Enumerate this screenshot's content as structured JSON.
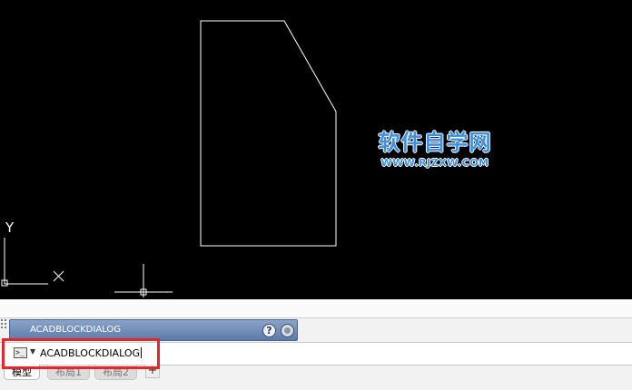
{
  "watermark": {
    "title": "软件自学网",
    "url": "WWW.RJZXW.COM"
  },
  "ucs": {
    "y_label": "Y",
    "x_label": "X"
  },
  "command_history": {
    "text": "ACADBLOCKDIALOG",
    "help_icon": "?"
  },
  "command_line": {
    "prompt_icon": ">_",
    "text": "ACADBLOCKDIALOG"
  },
  "tabs": [
    {
      "label": "模型",
      "active": true
    },
    {
      "label": "布局1",
      "active": false
    },
    {
      "label": "布局2",
      "active": false
    }
  ],
  "add_tab": "+",
  "colors": {
    "canvas": "#000000",
    "geometry": "#ffffff",
    "highlight": "#e5262a",
    "watermark": "#3d8fe0"
  }
}
